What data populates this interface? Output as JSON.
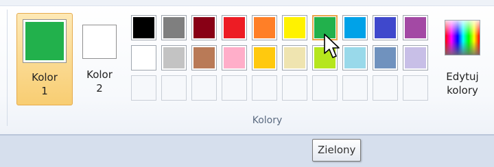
{
  "color1": {
    "label_line1": "Kolor",
    "label_line2": "1",
    "swatch_color": "#22b14c",
    "selected": true
  },
  "color2": {
    "label_line1": "Kolor",
    "label_line2": "2",
    "swatch_color": "#ffffff"
  },
  "palette": {
    "rows": [
      [
        "#000000",
        "#7f7f7f",
        "#880015",
        "#ed1c24",
        "#ff7f27",
        "#fff200",
        "#22b14c",
        "#00a2e8",
        "#3f48cc",
        "#a349a4"
      ],
      [
        "#ffffff",
        "#c3c3c3",
        "#b97a57",
        "#ffaec9",
        "#ffc90e",
        "#efe4b0",
        "#b5e61d",
        "#99d9ea",
        "#7092be",
        "#c8bfe7"
      ],
      [
        null,
        null,
        null,
        null,
        null,
        null,
        null,
        null,
        null,
        null
      ]
    ],
    "hovered": {
      "row": 0,
      "col": 6
    }
  },
  "edit_colors": {
    "label_line1": "Edytuj",
    "label_line2": "kolory",
    "icon": "color-spectrum-icon"
  },
  "group": {
    "label": "Kolory"
  },
  "tooltip": {
    "text": "Zielony"
  },
  "cursor": {
    "icon": "mouse-pointer-icon"
  },
  "colors": {
    "selected_border": "#e6aa4b",
    "group_label": "#5b6b80",
    "statusbar": "#d6dfed"
  }
}
